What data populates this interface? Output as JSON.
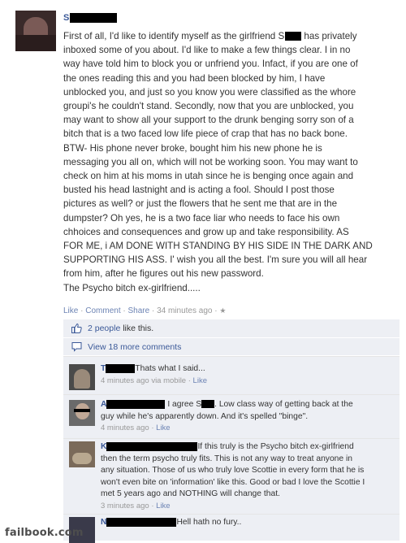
{
  "post": {
    "author": "S",
    "body_lines": [
      "First of all, I'd like to identify myself as the girlfriend S",
      " has privately",
      "inboxed some of you about. I'd like to make a few things clear. I in no",
      "way have told him to block you or unfriend you. Infact, if you are one of",
      "the ones reading this and you had been blocked by him, I have",
      "unblocked you, and just so you know you were classified as the whore",
      "groupi's he couldn't stand. Secondly, now that you are unblocked, you",
      "may want to show all your support to the drunk benging sorry son of a",
      "bitch that is a two faced low life piece of crap that has no back bone.",
      "BTW- His phone never broke, bought him his new phone he is",
      "messaging you all on, which will not be working soon. You may want to",
      "check on him at his moms in utah since he is benging once again and",
      "busted his head lastnight and is acting a fool. Should I post those",
      "pictures as well? or just the flowers that he sent me that are in the",
      "dumpster? Oh yes, he is a two face liar who needs to face his own",
      "chhoices and consequences and grow up and take responsibility. AS",
      "FOR ME, i AM DONE WITH STANDING BY HIS SIDE IN THE DARK AND",
      "SUPPORTING HIS ASS. I' wish you all the best. I'm sure you will all hear",
      "from him, after he figures out his new password.",
      "The Psycho bitch ex-girlfriend....."
    ],
    "actions": {
      "like": "Like",
      "comment": "Comment",
      "share": "Share",
      "time": "34 minutes ago"
    },
    "likes_text": "2 people",
    "likes_suffix": " like this.",
    "view_comments": "View 18 more comments"
  },
  "comments": [
    {
      "name": "T",
      "text": "Thats what I said...",
      "time": "4 minutes ago via mobile",
      "like": "Like"
    },
    {
      "name": "A",
      "text_a": "I agree S",
      "text_b": ". Low class way of getting back at the",
      "text_line2": "guy while he's apparently down. And it's spelled \"binge\".",
      "time": "4 minutes ago",
      "like": "Like"
    },
    {
      "name": "K",
      "text": [
        "If this truly is the Psycho bitch ex-girlfriend",
        "then the term psycho truly fits. This is not any way to treat anyone in",
        "any situation. Those of us who truly love Scottie in every form that he is",
        "won't even bite on 'information' like this. Good or bad I love the Scottie I",
        "met 5 years ago and NOTHING will change that."
      ],
      "time": "3 minutes ago",
      "like": "Like"
    },
    {
      "name": "N",
      "text": "Hell hath no fury.."
    }
  ],
  "watermark": "failbook.com",
  "colors": {
    "link": "#3b5998",
    "muted": "#999999",
    "panel": "#edeff4"
  }
}
